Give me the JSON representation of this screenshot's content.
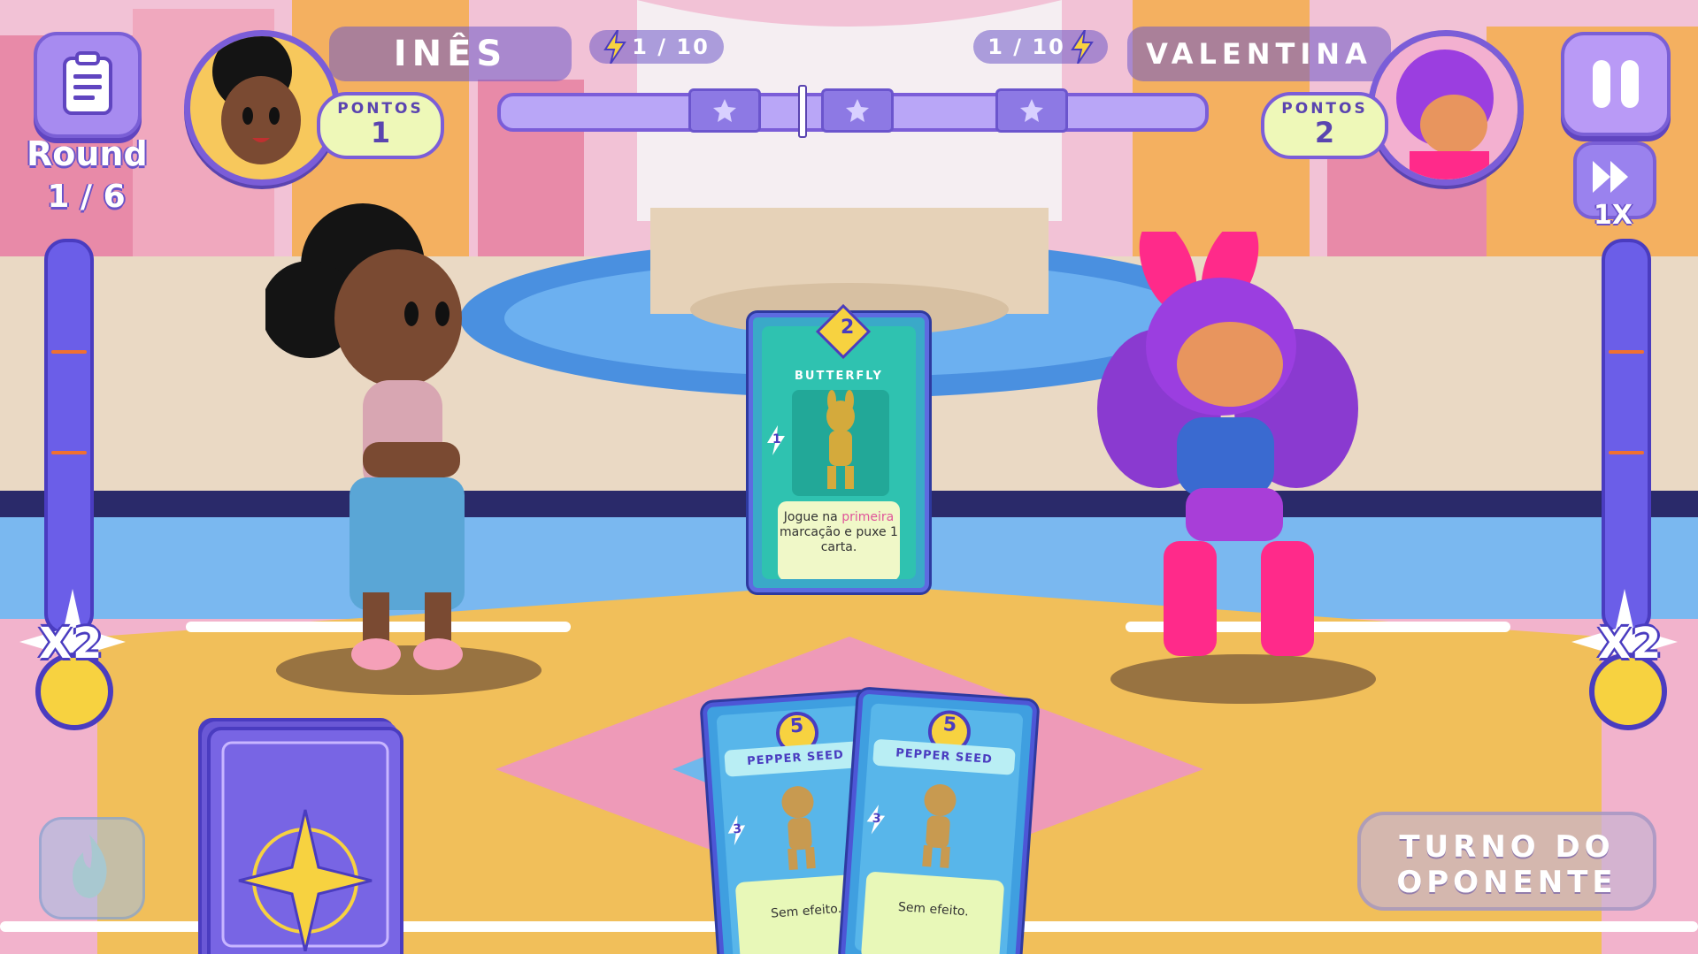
{
  "hud": {
    "round_label": "Round",
    "round_value": "1 / 6",
    "player": {
      "name": "INÊS",
      "points_label": "PONTOS",
      "points": "1",
      "energy": "1 / 10"
    },
    "opponent": {
      "name": "VALENTINA",
      "points_label": "PONTOS",
      "points": "2",
      "energy": "1 / 10"
    },
    "speed": "1X",
    "player_multiplier": "X2",
    "opponent_multiplier": "X2"
  },
  "played_card": {
    "cost": "2",
    "title": "BUTTERFLY",
    "power": "1",
    "text_before": "Jogue na ",
    "text_highlight": "primeira",
    "text_after": " marcação e puxe 1 carta."
  },
  "hand": [
    {
      "cost": "5",
      "title": "PEPPER SEED",
      "power": "3",
      "text": "Sem efeito."
    },
    {
      "cost": "5",
      "title": "PEPPER SEED",
      "power": "3",
      "text": "Sem efeito."
    }
  ],
  "turn_button": {
    "line1": "TURNO DO",
    "line2": "OPONENTE"
  },
  "colors": {
    "accent": "#7b5dd8",
    "highlight": "#e0559a",
    "coin": "#f7d240"
  },
  "icons": [
    "clipboard-icon",
    "pause-icon",
    "fast-forward-icon",
    "lightning-icon",
    "star-icon",
    "fire-icon",
    "compass-star-icon"
  ]
}
